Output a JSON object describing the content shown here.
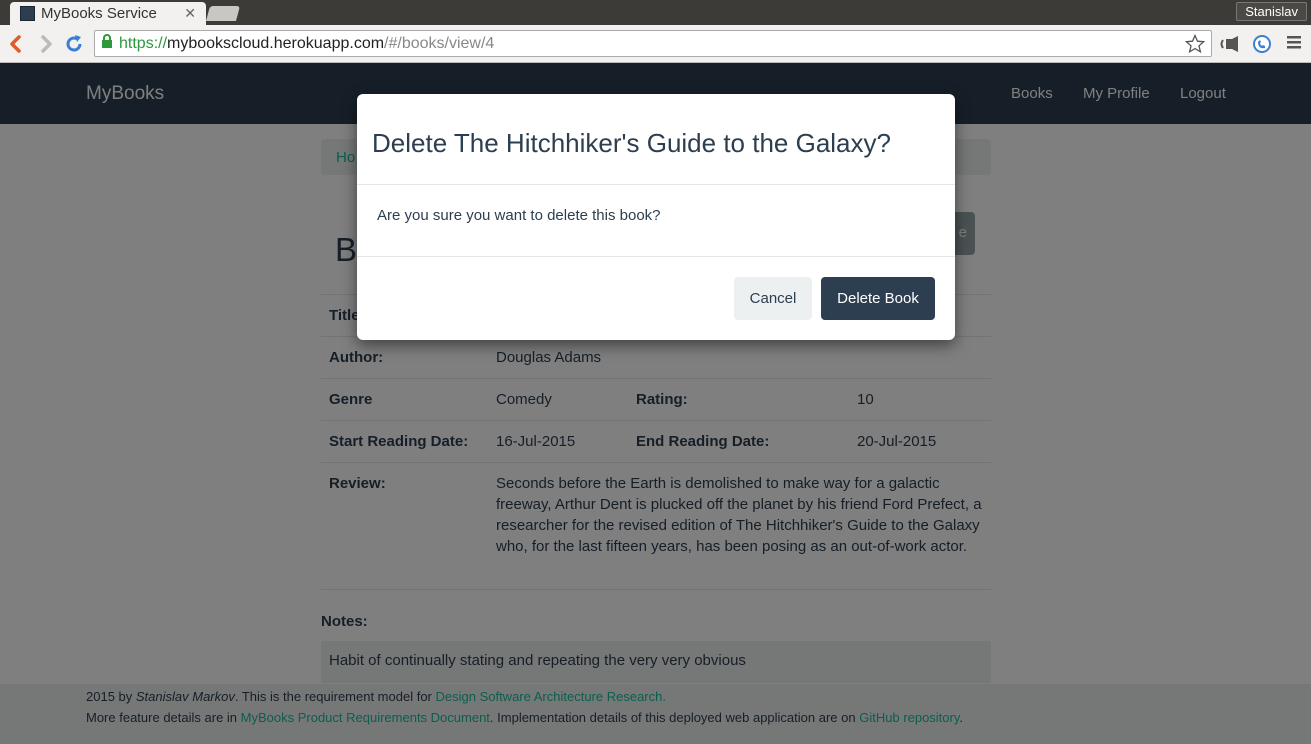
{
  "browser": {
    "tab_title": "MyBooks Service",
    "user_name": "Stanislav",
    "url_protocol": "https://",
    "url_host": "mybookscloud.herokuapp.com",
    "url_path": "/#/books/view/4"
  },
  "navbar": {
    "brand": "MyBooks",
    "links": [
      "Books",
      "My Profile",
      "Logout"
    ]
  },
  "breadcrumb": {
    "home": "Ho"
  },
  "page": {
    "heading_initial": "B",
    "edit_button": "e"
  },
  "book": {
    "title_label": "Title",
    "author_label": "Author:",
    "author": "Douglas Adams",
    "genre_label": "Genre",
    "genre": "Comedy",
    "rating_label": "Rating:",
    "rating": "10",
    "start_label": "Start Reading Date:",
    "start_date": "16-Jul-2015",
    "end_label": "End Reading Date:",
    "end_date": "20-Jul-2015",
    "review_label": "Review:",
    "review": "Seconds before the Earth is demolished to make way for a galactic freeway, Arthur Dent is plucked off the planet by his friend Ford Prefect, a researcher for the revised edition of The Hitchhiker's Guide to the Galaxy who, for the last fifteen years, has been posing as an out-of-work actor."
  },
  "notes": {
    "label": "Notes:",
    "text": "Habit of continually stating and repeating the very very obvious"
  },
  "footer": {
    "line1_prefix": "2015 by ",
    "author": "Stanislav Markov",
    "line1_mid": ". This is the requirement model for ",
    "line1_link": "Design Software Architecture Research.",
    "line2_prefix": "More feature details are in ",
    "line2_link1": "MyBooks Product Requirements Document",
    "line2_mid": ". Implementation details of this deployed web application are on ",
    "line2_link2": "GitHub repository",
    "line2_suffix": "."
  },
  "modal": {
    "title": "Delete The Hitchhiker's Guide to the Galaxy?",
    "body": "Are you sure you want to delete this book?",
    "cancel": "Cancel",
    "delete": "Delete Book"
  },
  "colors": {
    "primary": "#2c3e50",
    "accent": "#18bc9c",
    "light": "#ecf0f1"
  },
  "icons": [
    "back-icon",
    "forward-icon",
    "reload-icon",
    "lock-icon",
    "star-icon",
    "extension-icon"
  ]
}
